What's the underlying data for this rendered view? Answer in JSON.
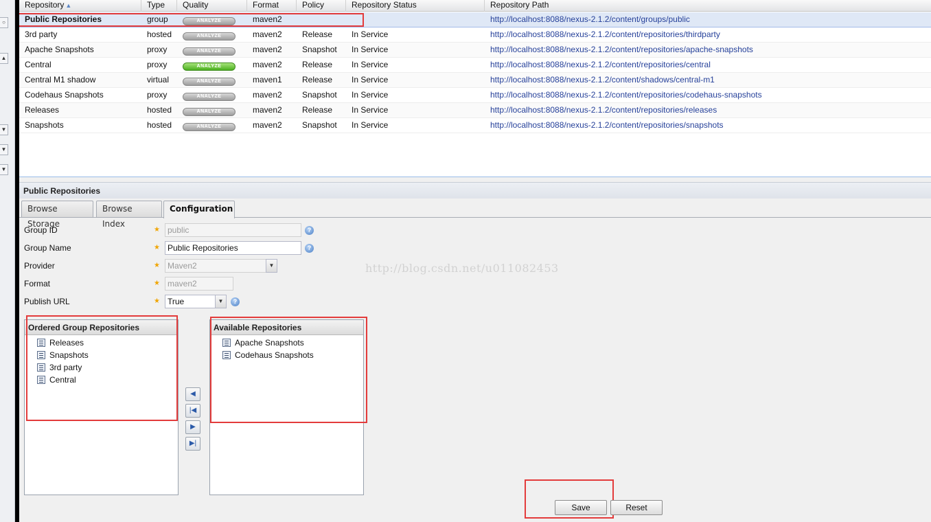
{
  "grid": {
    "columns": [
      "Repository",
      "Type",
      "Quality",
      "Format",
      "Policy",
      "Repository Status",
      "Repository Path"
    ],
    "rows": [
      {
        "name": "Public Repositories",
        "type": "group",
        "quality": "ANALYZE",
        "format": "maven2",
        "policy": "",
        "status": "",
        "path": "http://localhost:8088/nexus-2.1.2/content/groups/public"
      },
      {
        "name": "3rd party",
        "type": "hosted",
        "quality": "ANALYZE",
        "format": "maven2",
        "policy": "Release",
        "status": "In Service",
        "path": "http://localhost:8088/nexus-2.1.2/content/repositories/thirdparty"
      },
      {
        "name": "Apache Snapshots",
        "type": "proxy",
        "quality": "ANALYZE",
        "format": "maven2",
        "policy": "Snapshot",
        "status": "In Service",
        "path": "http://localhost:8088/nexus-2.1.2/content/repositories/apache-snapshots"
      },
      {
        "name": "Central",
        "type": "proxy",
        "quality": "ANALYZE",
        "format": "maven2",
        "policy": "Release",
        "status": "In Service",
        "path": "http://localhost:8088/nexus-2.1.2/content/repositories/central"
      },
      {
        "name": "Central M1 shadow",
        "type": "virtual",
        "quality": "ANALYZE",
        "format": "maven1",
        "policy": "Release",
        "status": "In Service",
        "path": "http://localhost:8088/nexus-2.1.2/content/shadows/central-m1"
      },
      {
        "name": "Codehaus Snapshots",
        "type": "proxy",
        "quality": "ANALYZE",
        "format": "maven2",
        "policy": "Snapshot",
        "status": "In Service",
        "path": "http://localhost:8088/nexus-2.1.2/content/repositories/codehaus-snapshots"
      },
      {
        "name": "Releases",
        "type": "hosted",
        "quality": "ANALYZE",
        "format": "maven2",
        "policy": "Release",
        "status": "In Service",
        "path": "http://localhost:8088/nexus-2.1.2/content/repositories/releases"
      },
      {
        "name": "Snapshots",
        "type": "hosted",
        "quality": "ANALYZE",
        "format": "maven2",
        "policy": "Snapshot",
        "status": "In Service",
        "path": "http://localhost:8088/nexus-2.1.2/content/repositories/snapshots"
      }
    ]
  },
  "detail": {
    "title": "Public Repositories",
    "tabs": [
      "Browse Storage",
      "Browse Index",
      "Configuration"
    ],
    "form": {
      "group_id_label": "Group ID",
      "group_id_value": "public",
      "group_name_label": "Group Name",
      "group_name_value": "Public Repositories",
      "provider_label": "Provider",
      "provider_value": "Maven2",
      "format_label": "Format",
      "format_value": "maven2",
      "publish_url_label": "Publish URL",
      "publish_url_value": "True"
    },
    "ordered": {
      "title": "Ordered Group Repositories",
      "items": [
        "Releases",
        "Snapshots",
        "3rd party",
        "Central"
      ]
    },
    "available": {
      "title": "Available Repositories",
      "items": [
        "Apache Snapshots",
        "Codehaus Snapshots"
      ]
    },
    "save_label": "Save",
    "reset_label": "Reset"
  },
  "watermark": "http://blog.csdn.net/u011082453",
  "icons": {
    "move_left": "arrow-left-icon",
    "move_all_left": "arrow-first-icon",
    "move_right": "arrow-right-icon",
    "move_all_right": "arrow-last-icon",
    "help": "help-icon",
    "repo": "repository-icon"
  },
  "colors": {
    "highlight_box": "#e33b3b",
    "selected_row": "#dfe8f6",
    "analyze_green": "#4bb020",
    "path_link": "#26419a"
  }
}
